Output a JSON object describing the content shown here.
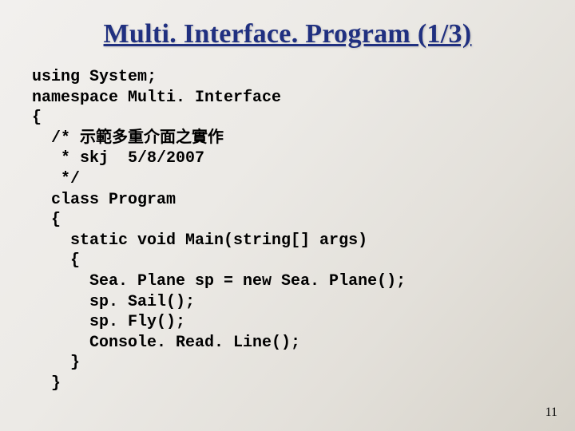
{
  "title": "Multi. Interface. Program (1/3)",
  "code": {
    "l01": "using System;",
    "l02": "namespace Multi. Interface",
    "l03": "{",
    "l04": "  /* 示範多重介面之實作",
    "l05": "   * skj  5/8/2007",
    "l06": "   */",
    "l07": "  class Program",
    "l08": "  {",
    "l09": "    static void Main(string[] args)",
    "l10": "    {",
    "l11": "      Sea. Plane sp = new Sea. Plane();",
    "l12": "      sp. Sail();",
    "l13": "      sp. Fly();",
    "l14": "      Console. Read. Line();",
    "l15": "    }",
    "l16": "  }"
  },
  "page_number": "11"
}
